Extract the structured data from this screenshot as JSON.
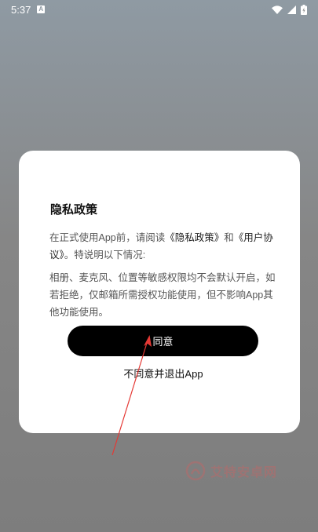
{
  "status_bar": {
    "time": "5:37",
    "notification_icon": "A"
  },
  "dialog": {
    "title": "隐私政策",
    "p1_prefix": "在正式使用App前，请阅读",
    "p1_policy_link": "《隐私政策》",
    "p1_and": "和",
    "p1_agreement_link": "《用户协议》",
    "p1_suffix": "。特说明以下情况:",
    "p2": "相册、麦克风、位置等敏感权限均不会默认开启，如若拒绝，仅邮箱所需授权功能使用，但不影响App其他功能使用。",
    "agree_label": "同意",
    "disagree_label": "不同意并退出App"
  },
  "watermark": {
    "text": "艾特安卓网"
  },
  "colors": {
    "annotation": "#e53935",
    "button_bg": "#000000",
    "dialog_bg": "#ffffff"
  }
}
